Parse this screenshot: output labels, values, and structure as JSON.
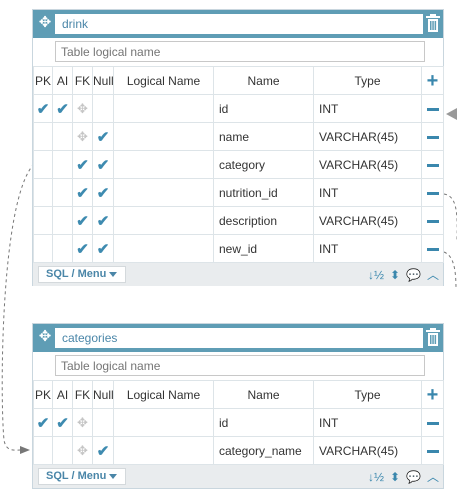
{
  "columns": [
    "PK",
    "AI",
    "FK",
    "Null",
    "Logical Name",
    "Name",
    "Type"
  ],
  "sql_menu_label": "SQL / Menu",
  "tables": [
    {
      "name": "drink",
      "logical_placeholder": "Table logical name",
      "rows": [
        {
          "pk": true,
          "ai": true,
          "fk": false,
          "null": false,
          "logical": "",
          "name": "id",
          "type": "INT"
        },
        {
          "pk": false,
          "ai": false,
          "fk": false,
          "null": true,
          "logical": "",
          "name": "name",
          "type": "VARCHAR(45)"
        },
        {
          "pk": false,
          "ai": false,
          "fk": true,
          "null": true,
          "logical": "",
          "name": "category",
          "type": "VARCHAR(45)"
        },
        {
          "pk": false,
          "ai": false,
          "fk": true,
          "null": true,
          "logical": "",
          "name": "nutrition_id",
          "type": "INT"
        },
        {
          "pk": false,
          "ai": false,
          "fk": true,
          "null": true,
          "logical": "",
          "name": "description",
          "type": "VARCHAR(45)"
        },
        {
          "pk": false,
          "ai": false,
          "fk": true,
          "null": true,
          "logical": "",
          "name": "new_id",
          "type": "INT"
        }
      ]
    },
    {
      "name": "categories",
      "logical_placeholder": "Table logical name",
      "rows": [
        {
          "pk": true,
          "ai": true,
          "fk": false,
          "null": false,
          "logical": "",
          "name": "id",
          "type": "INT"
        },
        {
          "pk": false,
          "ai": false,
          "fk": false,
          "null": true,
          "logical": "",
          "name": "category_name",
          "type": "VARCHAR(45)"
        }
      ]
    }
  ],
  "colors": {
    "header": "#5f9db5",
    "accent": "#3a87ad",
    "footer": "#e9ecee"
  }
}
